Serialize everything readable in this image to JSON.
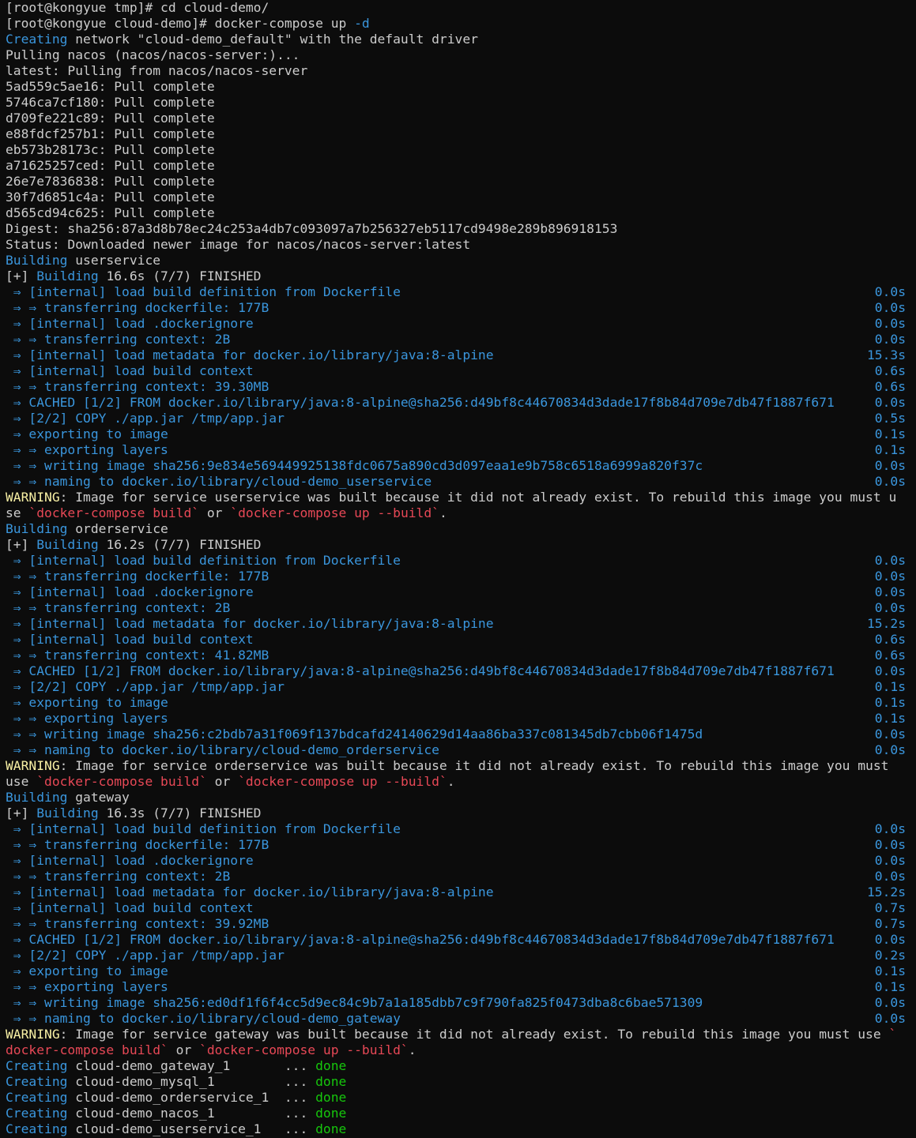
{
  "colors": {
    "background": "#0c0c0c",
    "text": "#cccccc",
    "blue": "#3a96dd",
    "yellow": "#f9f1a5",
    "red": "#e74856",
    "green": "#16c60c"
  },
  "lines": [
    {
      "kind": "prompt",
      "segs": [
        {
          "t": "[root@kongyue tmp]# cd cloud-demo/",
          "c": "white"
        }
      ]
    },
    {
      "kind": "prompt",
      "segs": [
        {
          "t": "[root@kongyue cloud-demo]# docker-compose up ",
          "c": "white"
        },
        {
          "t": "-d",
          "c": "blue"
        }
      ]
    },
    {
      "kind": "output",
      "segs": [
        {
          "t": "Creating",
          "c": "blue"
        },
        {
          "t": " network \"cloud-demo_default\" with the default driver",
          "c": "white"
        }
      ]
    },
    {
      "kind": "output",
      "segs": [
        {
          "t": "Pulling nacos (nacos/nacos-server:)...",
          "c": "white"
        }
      ]
    },
    {
      "kind": "output",
      "segs": [
        {
          "t": "latest: Pulling from nacos/nacos-server",
          "c": "white"
        }
      ]
    },
    {
      "kind": "output",
      "segs": [
        {
          "t": "5ad559c5ae16: Pull complete",
          "c": "white"
        }
      ]
    },
    {
      "kind": "output",
      "segs": [
        {
          "t": "5746ca7cf180: Pull complete",
          "c": "white"
        }
      ]
    },
    {
      "kind": "output",
      "segs": [
        {
          "t": "d709fe221c89: Pull complete",
          "c": "white"
        }
      ]
    },
    {
      "kind": "output",
      "segs": [
        {
          "t": "e88fdcf257b1: Pull complete",
          "c": "white"
        }
      ]
    },
    {
      "kind": "output",
      "segs": [
        {
          "t": "eb573b28173c: Pull complete",
          "c": "white"
        }
      ]
    },
    {
      "kind": "output",
      "segs": [
        {
          "t": "a71625257ced: Pull complete",
          "c": "white"
        }
      ]
    },
    {
      "kind": "output",
      "segs": [
        {
          "t": "26e7e7836838: Pull complete",
          "c": "white"
        }
      ]
    },
    {
      "kind": "output",
      "segs": [
        {
          "t": "30f7d6851c4a: Pull complete",
          "c": "white"
        }
      ]
    },
    {
      "kind": "output",
      "segs": [
        {
          "t": "d565cd94c625: Pull complete",
          "c": "white"
        }
      ]
    },
    {
      "kind": "output",
      "segs": [
        {
          "t": "Digest: sha256:87a3d8b78ec24c253a4db7c093097a7b256327eb5117cd9498e289b896918153",
          "c": "white"
        }
      ]
    },
    {
      "kind": "output",
      "segs": [
        {
          "t": "Status: Downloaded newer image for nacos/nacos-server:latest",
          "c": "white"
        }
      ]
    },
    {
      "kind": "output",
      "segs": [
        {
          "t": "Building",
          "c": "blue"
        },
        {
          "t": " userservice",
          "c": "white"
        }
      ]
    },
    {
      "kind": "output",
      "segs": [
        {
          "t": "[+] ",
          "c": "white"
        },
        {
          "t": "Building",
          "c": "blue"
        },
        {
          "t": " 16.6s (7/7) FINISHED",
          "c": "white"
        }
      ]
    },
    {
      "kind": "step",
      "segs": [
        {
          "t": " ⇒ [internal] load build definition from Dockerfile",
          "c": "blue"
        }
      ],
      "dur": "0.0s"
    },
    {
      "kind": "step",
      "segs": [
        {
          "t": " ⇒ ⇒ transferring dockerfile: 177B",
          "c": "blue"
        }
      ],
      "dur": "0.0s"
    },
    {
      "kind": "step",
      "segs": [
        {
          "t": " ⇒ [internal] load .dockerignore",
          "c": "blue"
        }
      ],
      "dur": "0.0s"
    },
    {
      "kind": "step",
      "segs": [
        {
          "t": " ⇒ ⇒ transferring context: 2B",
          "c": "blue"
        }
      ],
      "dur": "0.0s"
    },
    {
      "kind": "step",
      "segs": [
        {
          "t": " ⇒ [internal] load metadata for docker.io/library/java:8-alpine",
          "c": "blue"
        }
      ],
      "dur": "15.3s"
    },
    {
      "kind": "step",
      "segs": [
        {
          "t": " ⇒ [internal] load build context",
          "c": "blue"
        }
      ],
      "dur": "0.6s"
    },
    {
      "kind": "step",
      "segs": [
        {
          "t": " ⇒ ⇒ transferring context: 39.30MB",
          "c": "blue"
        }
      ],
      "dur": "0.6s"
    },
    {
      "kind": "step",
      "segs": [
        {
          "t": " ⇒ CACHED [1/2] FROM docker.io/library/java:8-alpine@sha256:d49bf8c44670834d3dade17f8b84d709e7db47f1887f671",
          "c": "blue"
        }
      ],
      "dur": "0.0s"
    },
    {
      "kind": "step",
      "segs": [
        {
          "t": " ⇒ [2/2] COPY ./app.jar /tmp/app.jar",
          "c": "blue"
        }
      ],
      "dur": "0.5s"
    },
    {
      "kind": "step",
      "segs": [
        {
          "t": " ⇒ exporting to image",
          "c": "blue"
        }
      ],
      "dur": "0.1s"
    },
    {
      "kind": "step",
      "segs": [
        {
          "t": " ⇒ ⇒ exporting layers",
          "c": "blue"
        }
      ],
      "dur": "0.1s"
    },
    {
      "kind": "step",
      "segs": [
        {
          "t": " ⇒ ⇒ writing image sha256:9e834e569449925138fdc0675a890cd3d097eaa1e9b758c6518a6999a820f37c",
          "c": "blue"
        }
      ],
      "dur": "0.0s"
    },
    {
      "kind": "step",
      "segs": [
        {
          "t": " ⇒ ⇒ naming to docker.io/library/cloud-demo_userservice",
          "c": "blue"
        }
      ],
      "dur": "0.0s"
    },
    {
      "kind": "warning",
      "segs": [
        {
          "t": "WARNING",
          "c": "yellow"
        },
        {
          "t": ": Image for service userservice was built because it did not already exist. To rebuild this image you must u",
          "c": "white"
        }
      ]
    },
    {
      "kind": "warning",
      "segs": [
        {
          "t": "se ",
          "c": "white"
        },
        {
          "t": "`docker-compose build`",
          "c": "red"
        },
        {
          "t": " or ",
          "c": "white"
        },
        {
          "t": "`docker-compose up --build`",
          "c": "red"
        },
        {
          "t": ".",
          "c": "white"
        }
      ]
    },
    {
      "kind": "output",
      "segs": [
        {
          "t": "Building",
          "c": "blue"
        },
        {
          "t": " orderservice",
          "c": "white"
        }
      ]
    },
    {
      "kind": "output",
      "segs": [
        {
          "t": "[+] ",
          "c": "white"
        },
        {
          "t": "Building",
          "c": "blue"
        },
        {
          "t": " 16.2s (7/7) FINISHED",
          "c": "white"
        }
      ]
    },
    {
      "kind": "step",
      "segs": [
        {
          "t": " ⇒ [internal] load build definition from Dockerfile",
          "c": "blue"
        }
      ],
      "dur": "0.0s"
    },
    {
      "kind": "step",
      "segs": [
        {
          "t": " ⇒ ⇒ transferring dockerfile: 177B",
          "c": "blue"
        }
      ],
      "dur": "0.0s"
    },
    {
      "kind": "step",
      "segs": [
        {
          "t": " ⇒ [internal] load .dockerignore",
          "c": "blue"
        }
      ],
      "dur": "0.0s"
    },
    {
      "kind": "step",
      "segs": [
        {
          "t": " ⇒ ⇒ transferring context: 2B",
          "c": "blue"
        }
      ],
      "dur": "0.0s"
    },
    {
      "kind": "step",
      "segs": [
        {
          "t": " ⇒ [internal] load metadata for docker.io/library/java:8-alpine",
          "c": "blue"
        }
      ],
      "dur": "15.2s"
    },
    {
      "kind": "step",
      "segs": [
        {
          "t": " ⇒ [internal] load build context",
          "c": "blue"
        }
      ],
      "dur": "0.6s"
    },
    {
      "kind": "step",
      "segs": [
        {
          "t": " ⇒ ⇒ transferring context: 41.82MB",
          "c": "blue"
        }
      ],
      "dur": "0.6s"
    },
    {
      "kind": "step",
      "segs": [
        {
          "t": " ⇒ CACHED [1/2] FROM docker.io/library/java:8-alpine@sha256:d49bf8c44670834d3dade17f8b84d709e7db47f1887f671",
          "c": "blue"
        }
      ],
      "dur": "0.0s"
    },
    {
      "kind": "step",
      "segs": [
        {
          "t": " ⇒ [2/2] COPY ./app.jar /tmp/app.jar",
          "c": "blue"
        }
      ],
      "dur": "0.1s"
    },
    {
      "kind": "step",
      "segs": [
        {
          "t": " ⇒ exporting to image",
          "c": "blue"
        }
      ],
      "dur": "0.1s"
    },
    {
      "kind": "step",
      "segs": [
        {
          "t": " ⇒ ⇒ exporting layers",
          "c": "blue"
        }
      ],
      "dur": "0.1s"
    },
    {
      "kind": "step",
      "segs": [
        {
          "t": " ⇒ ⇒ writing image sha256:c2bdb7a31f069f137bdcafd24140629d14aa86ba337c081345db7cbb06f1475d",
          "c": "blue"
        }
      ],
      "dur": "0.0s"
    },
    {
      "kind": "step",
      "segs": [
        {
          "t": " ⇒ ⇒ naming to docker.io/library/cloud-demo_orderservice",
          "c": "blue"
        }
      ],
      "dur": "0.0s"
    },
    {
      "kind": "warning",
      "segs": [
        {
          "t": "WARNING",
          "c": "yellow"
        },
        {
          "t": ": Image for service orderservice was built because it did not already exist. To rebuild this image you must",
          "c": "white"
        }
      ]
    },
    {
      "kind": "warning",
      "segs": [
        {
          "t": "use ",
          "c": "white"
        },
        {
          "t": "`docker-compose build`",
          "c": "red"
        },
        {
          "t": " or ",
          "c": "white"
        },
        {
          "t": "`docker-compose up --build`",
          "c": "red"
        },
        {
          "t": ".",
          "c": "white"
        }
      ]
    },
    {
      "kind": "output",
      "segs": [
        {
          "t": "Building",
          "c": "blue"
        },
        {
          "t": " gateway",
          "c": "white"
        }
      ]
    },
    {
      "kind": "output",
      "segs": [
        {
          "t": "[+] ",
          "c": "white"
        },
        {
          "t": "Building",
          "c": "blue"
        },
        {
          "t": " 16.3s (7/7) FINISHED",
          "c": "white"
        }
      ]
    },
    {
      "kind": "step",
      "segs": [
        {
          "t": " ⇒ [internal] load build definition from Dockerfile",
          "c": "blue"
        }
      ],
      "dur": "0.0s"
    },
    {
      "kind": "step",
      "segs": [
        {
          "t": " ⇒ ⇒ transferring dockerfile: 177B",
          "c": "blue"
        }
      ],
      "dur": "0.0s"
    },
    {
      "kind": "step",
      "segs": [
        {
          "t": " ⇒ [internal] load .dockerignore",
          "c": "blue"
        }
      ],
      "dur": "0.0s"
    },
    {
      "kind": "step",
      "segs": [
        {
          "t": " ⇒ ⇒ transferring context: 2B",
          "c": "blue"
        }
      ],
      "dur": "0.0s"
    },
    {
      "kind": "step",
      "segs": [
        {
          "t": " ⇒ [internal] load metadata for docker.io/library/java:8-alpine",
          "c": "blue"
        }
      ],
      "dur": "15.2s"
    },
    {
      "kind": "step",
      "segs": [
        {
          "t": " ⇒ [internal] load build context",
          "c": "blue"
        }
      ],
      "dur": "0.7s"
    },
    {
      "kind": "step",
      "segs": [
        {
          "t": " ⇒ ⇒ transferring context: 39.92MB",
          "c": "blue"
        }
      ],
      "dur": "0.7s"
    },
    {
      "kind": "step",
      "segs": [
        {
          "t": " ⇒ CACHED [1/2] FROM docker.io/library/java:8-alpine@sha256:d49bf8c44670834d3dade17f8b84d709e7db47f1887f671",
          "c": "blue"
        }
      ],
      "dur": "0.0s"
    },
    {
      "kind": "step",
      "segs": [
        {
          "t": " ⇒ [2/2] COPY ./app.jar /tmp/app.jar",
          "c": "blue"
        }
      ],
      "dur": "0.2s"
    },
    {
      "kind": "step",
      "segs": [
        {
          "t": " ⇒ exporting to image",
          "c": "blue"
        }
      ],
      "dur": "0.1s"
    },
    {
      "kind": "step",
      "segs": [
        {
          "t": " ⇒ ⇒ exporting layers",
          "c": "blue"
        }
      ],
      "dur": "0.1s"
    },
    {
      "kind": "step",
      "segs": [
        {
          "t": " ⇒ ⇒ writing image sha256:ed0df1f6f4cc5d9ec84c9b7a1a185dbb7c9f790fa825f0473dba8c6bae571309",
          "c": "blue"
        }
      ],
      "dur": "0.0s"
    },
    {
      "kind": "step",
      "segs": [
        {
          "t": " ⇒ ⇒ naming to docker.io/library/cloud-demo_gateway",
          "c": "blue"
        }
      ],
      "dur": "0.0s"
    },
    {
      "kind": "warning",
      "segs": [
        {
          "t": "WARNING",
          "c": "yellow"
        },
        {
          "t": ": Image for service gateway was built because it did not already exist. To rebuild this image you must use ",
          "c": "white"
        },
        {
          "t": "`",
          "c": "red"
        }
      ]
    },
    {
      "kind": "warning",
      "segs": [
        {
          "t": "docker-compose build`",
          "c": "red"
        },
        {
          "t": " or ",
          "c": "white"
        },
        {
          "t": "`docker-compose up --build`",
          "c": "red"
        },
        {
          "t": ".",
          "c": "white"
        }
      ]
    },
    {
      "kind": "create",
      "segs": [
        {
          "t": "Creating",
          "c": "blue"
        },
        {
          "t": " cloud-demo_gateway_1       ... ",
          "c": "white"
        },
        {
          "t": "done",
          "c": "green"
        }
      ]
    },
    {
      "kind": "create",
      "segs": [
        {
          "t": "Creating",
          "c": "blue"
        },
        {
          "t": " cloud-demo_mysql_1         ... ",
          "c": "white"
        },
        {
          "t": "done",
          "c": "green"
        }
      ]
    },
    {
      "kind": "create",
      "segs": [
        {
          "t": "Creating",
          "c": "blue"
        },
        {
          "t": " cloud-demo_orderservice_1  ... ",
          "c": "white"
        },
        {
          "t": "done",
          "c": "green"
        }
      ]
    },
    {
      "kind": "create",
      "segs": [
        {
          "t": "Creating",
          "c": "blue"
        },
        {
          "t": " cloud-demo_nacos_1         ... ",
          "c": "white"
        },
        {
          "t": "done",
          "c": "green"
        }
      ]
    },
    {
      "kind": "create",
      "segs": [
        {
          "t": "Creating",
          "c": "blue"
        },
        {
          "t": " cloud-demo_userservice_1   ... ",
          "c": "white"
        },
        {
          "t": "done",
          "c": "green"
        }
      ]
    }
  ]
}
